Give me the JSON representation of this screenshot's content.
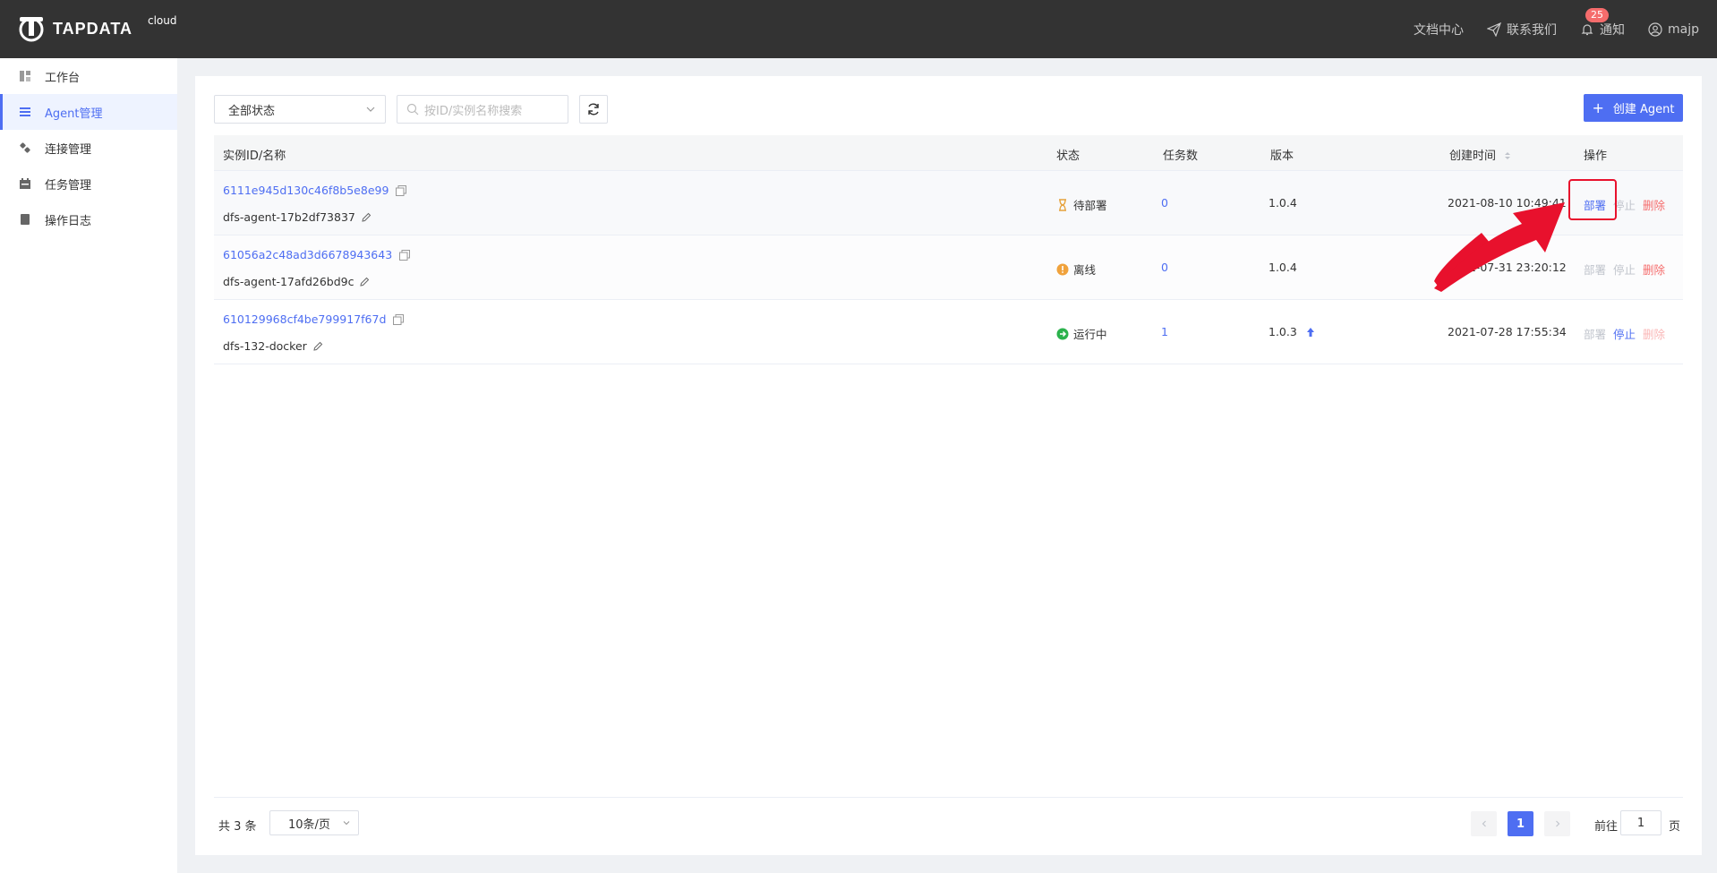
{
  "header": {
    "logo_text": "TAPDATA",
    "logo_sup": "cloud",
    "docs": "文档中心",
    "contact": "联系我们",
    "notify_count": "25",
    "notify": "通知",
    "user": "majp"
  },
  "sidebar": {
    "items": [
      {
        "label": "工作台",
        "icon": "dashboard-icon"
      },
      {
        "label": "Agent管理",
        "icon": "list-icon",
        "active": true
      },
      {
        "label": "连接管理",
        "icon": "link-icon"
      },
      {
        "label": "任务管理",
        "icon": "calendar-icon"
      },
      {
        "label": "操作日志",
        "icon": "log-icon"
      }
    ]
  },
  "toolbar": {
    "status_select": "全部状态",
    "search_placeholder": "按ID/实例名称搜索",
    "create_button": "创建 Agent"
  },
  "table": {
    "columns": [
      "实例ID/名称",
      "状态",
      "任务数",
      "版本",
      "创建时间",
      "操作"
    ],
    "rows": [
      {
        "id": "6111e945d130c46f8b5e8e99",
        "name": "dfs-agent-17b2df73837",
        "status": "待部署",
        "tasks": "0",
        "version": "1.0.4",
        "created": "2021-08-10 10:49:41",
        "op_deploy": "部署",
        "op_stop": "停止",
        "op_delete": "删除"
      },
      {
        "id": "61056a2c48ad3d6678943643",
        "name": "dfs-agent-17afd26bd9c",
        "status": "离线",
        "tasks": "0",
        "version": "1.0.4",
        "created": "2021-07-31 23:20:12",
        "op_deploy": "部署",
        "op_stop": "停止",
        "op_delete": "删除"
      },
      {
        "id": "610129968cf4be799917f67d",
        "name": "dfs-132-docker",
        "status": "运行中",
        "tasks": "1",
        "version": "1.0.3",
        "created": "2021-07-28 17:55:34",
        "op_deploy": "部署",
        "op_stop": "停止",
        "op_delete": "删除"
      }
    ]
  },
  "pagination": {
    "total": "共 3 条",
    "page_size": "10条/页",
    "current": "1",
    "goto_label": "前往",
    "goto_value": "1",
    "goto_unit": "页"
  },
  "colors": {
    "accent": "#4e6ef2",
    "danger": "#f56c6c",
    "header": "#333333",
    "highlight": "#e8112d"
  }
}
